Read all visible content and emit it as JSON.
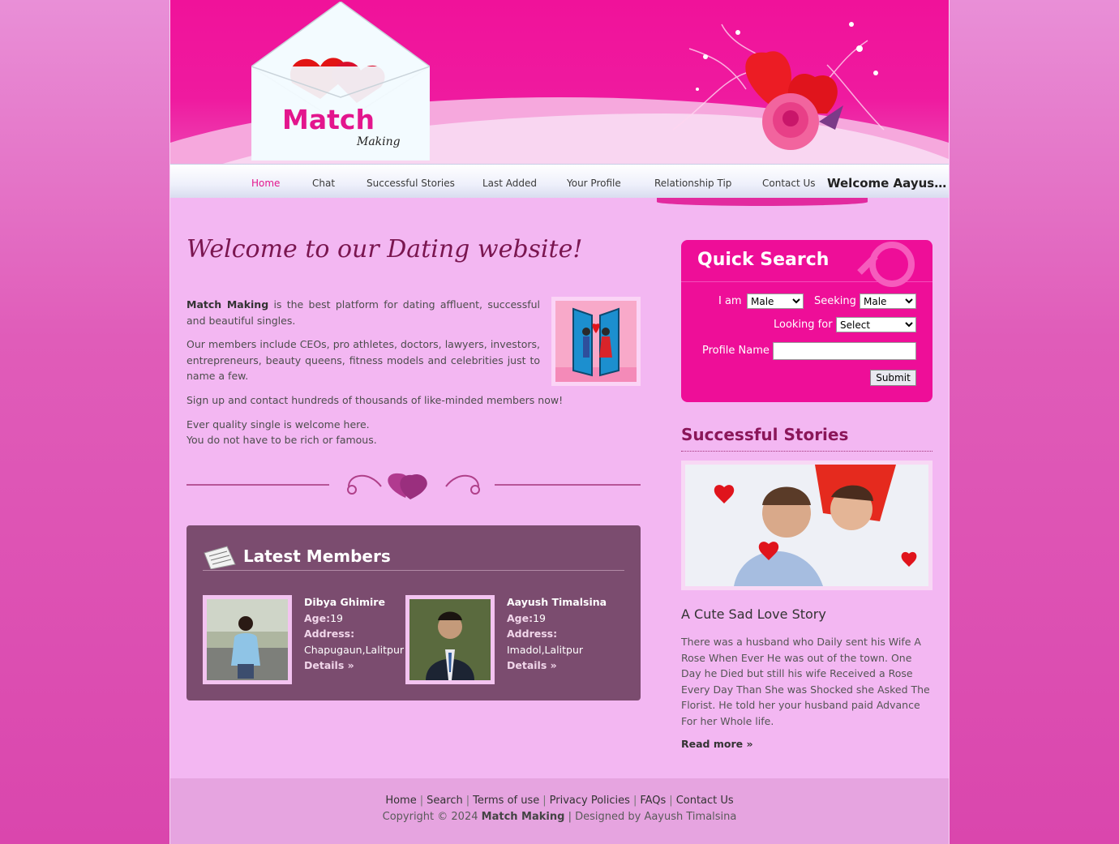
{
  "logo": {
    "title": "Match",
    "subtitle": "Making"
  },
  "nav": {
    "items": [
      {
        "label": "Home"
      },
      {
        "label": "Chat"
      },
      {
        "label": "Successful Stories"
      },
      {
        "label": "Last Added"
      },
      {
        "label": "Your Profile"
      },
      {
        "label": "Relationship Tip"
      },
      {
        "label": "Contact Us"
      }
    ],
    "active": "Home",
    "welcome": "Welcome Aayush Timalsina"
  },
  "main": {
    "heading": "Welcome to our Dating website!",
    "intro_brand": "Match Making",
    "intro_p1_rest": " is the best platform for dating affluent, successful and beautiful singles.",
    "intro_p2": "Our members include CEOs, pro athletes, doctors, lawyers, investors, entrepreneurs, beauty queens, fitness models and celebrities just to name a few.",
    "intro_p3": "Sign up and contact hundreds of thousands of like-minded members now!",
    "intro_p4_line1": "Ever quality single is welcome here.",
    "intro_p4_line2": "You do not have to be rich or famous."
  },
  "latest_members": {
    "title": "Latest Members",
    "age_label": "Age:",
    "address_label": "Address:",
    "details_label": "Details »",
    "members": [
      {
        "name": "Dibya Ghimire",
        "age": "19",
        "address": "Chapugaun,Lalitpur"
      },
      {
        "name": "Aayush Timalsina",
        "age": "19",
        "address": "Imadol,Lalitpur"
      }
    ]
  },
  "quick_search": {
    "title": "Quick Search",
    "i_am_label": "I am",
    "i_am_value": "Male",
    "seeking_label": "Seeking",
    "seeking_value": "Male",
    "looking_label": "Looking for",
    "looking_value": "Select",
    "profile_label": "Profile Name",
    "profile_value": "",
    "submit_label": "Submit"
  },
  "stories": {
    "title": "Successful Stories",
    "story_title": "A Cute Sad Love Story",
    "story_text": "There was a husband who Daily sent his Wife A Rose When Ever He was out of the town. One Day he Died but still his wife Received a Rose Every Day Than She was Shocked she Asked The Florist. He told her your husband paid Advance For her Whole life.",
    "read_more": "Read more »"
  },
  "footer": {
    "links": [
      "Home",
      "Search",
      "Terms of use",
      "Privacy Policies",
      "FAQs",
      "Contact Us"
    ],
    "copyright_prefix": "Copyright © 2024",
    "copyright_brand": "Match Making",
    "designed_by": "Designed by Aayush Timalsina"
  },
  "colors": {
    "brand_pink": "#ee0e98",
    "members_panel": "#7b4c6f",
    "page_bg": "#f3b7f2"
  }
}
